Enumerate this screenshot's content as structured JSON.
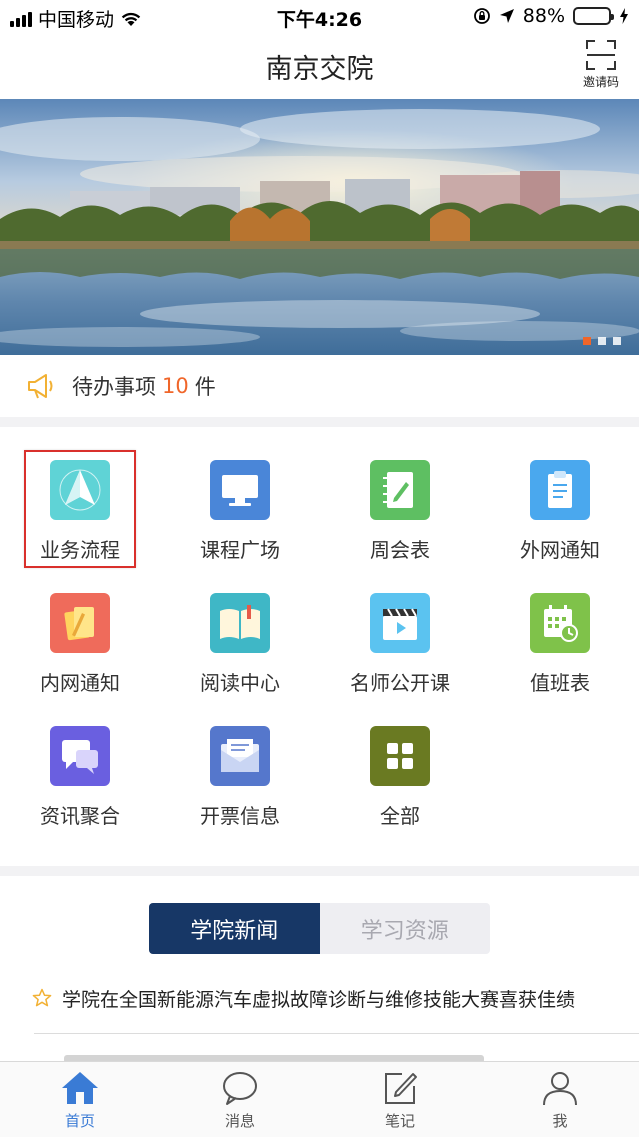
{
  "status_bar": {
    "carrier": "中国移动",
    "time": "下午4:26",
    "battery": "88%",
    "battery_level": 0.88
  },
  "nav": {
    "title": "南京交院",
    "invite_label": "邀请码"
  },
  "banner": {
    "pages": 3,
    "active_page": 1
  },
  "todo": {
    "prefix": "待办事项",
    "count": "10",
    "suffix": "件"
  },
  "grid": {
    "items": [
      {
        "label": "业务流程",
        "icon": "compass-icon",
        "color": "#5fd3d6"
      },
      {
        "label": "课程广场",
        "icon": "monitor-icon",
        "color": "#4a86d8"
      },
      {
        "label": "周会表",
        "icon": "notebook-pen-icon",
        "color": "#5ebf62"
      },
      {
        "label": "外网通知",
        "icon": "clipboard-icon",
        "color": "#4aa8ee"
      },
      {
        "label": "内网通知",
        "icon": "notes-pencil-icon",
        "color": "#ef6b5b"
      },
      {
        "label": "阅读中心",
        "icon": "open-book-icon",
        "color": "#3fb7c6"
      },
      {
        "label": "名师公开课",
        "icon": "clapperboard-icon",
        "color": "#5bc3f0"
      },
      {
        "label": "值班表",
        "icon": "calendar-clock-icon",
        "color": "#7fc24a"
      },
      {
        "label": "资讯聚合",
        "icon": "chat-bubbles-icon",
        "color": "#6a5fe0"
      },
      {
        "label": "开票信息",
        "icon": "envelope-icon",
        "color": "#5577cc"
      },
      {
        "label": "全部",
        "icon": "grid-four-icon",
        "color": "#6a7a22"
      }
    ]
  },
  "segmented": {
    "tabs": [
      "学院新闻",
      "学习资源"
    ],
    "active": 0
  },
  "news": {
    "items": [
      {
        "title": "学院在全国新能源汽车虚拟故障诊断与维修技能大赛喜获佳绩"
      }
    ]
  },
  "tab_bar": {
    "items": [
      {
        "label": "首页",
        "icon": "home-icon"
      },
      {
        "label": "消息",
        "icon": "chat-icon"
      },
      {
        "label": "笔记",
        "icon": "edit-note-icon"
      },
      {
        "label": "我",
        "icon": "user-icon"
      }
    ],
    "active": 0
  },
  "colors": {
    "accent": "#f0662a",
    "segmented_active": "#173766",
    "highlight": "#d9302c",
    "tab_active": "#3a7bd5"
  }
}
